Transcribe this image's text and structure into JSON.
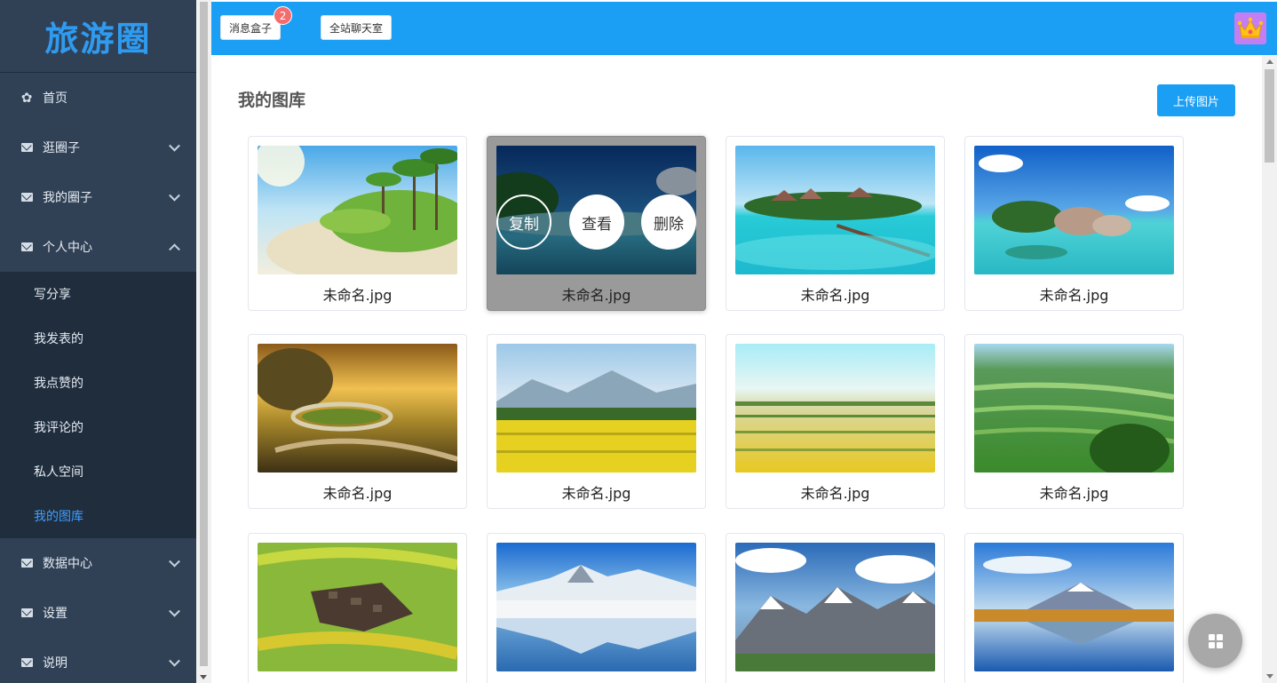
{
  "logo": "旅游圈",
  "sidebar": {
    "items": [
      {
        "label": "首页",
        "icon": "gear-icon"
      },
      {
        "label": "逛圈子",
        "icon": "envelope-icon"
      },
      {
        "label": "我的圈子",
        "icon": "envelope-icon"
      },
      {
        "label": "个人中心",
        "icon": "envelope-icon",
        "expanded": true
      },
      {
        "label": "数据中心",
        "icon": "envelope-icon"
      },
      {
        "label": "设置",
        "icon": "envelope-icon"
      },
      {
        "label": "说明",
        "icon": "envelope-icon"
      }
    ],
    "submenu": [
      {
        "label": "写分享"
      },
      {
        "label": "我发表的"
      },
      {
        "label": "我点赞的"
      },
      {
        "label": "我评论的"
      },
      {
        "label": "私人空间"
      },
      {
        "label": "我的图库",
        "active": true
      }
    ]
  },
  "header": {
    "message_box": "消息盒子",
    "message_badge": "2",
    "chatroom": "全站聊天室",
    "avatar_icon": "crown-icon",
    "bg_color": "#1a9ff5"
  },
  "main": {
    "title": "我的图库",
    "upload_button": "上传图片",
    "hover_actions": {
      "copy": "复制",
      "view": "查看",
      "delete": "删除"
    },
    "images": [
      {
        "name": "未命名.jpg",
        "scene": "beach-palms"
      },
      {
        "name": "未命名.jpg",
        "scene": "sea-island-hover"
      },
      {
        "name": "未命名.jpg",
        "scene": "lagoon-huts"
      },
      {
        "name": "未命名.jpg",
        "scene": "rocky-beach"
      },
      {
        "name": "未命名.jpg",
        "scene": "racetrack-sunset"
      },
      {
        "name": "未命名.jpg",
        "scene": "mountain-fields"
      },
      {
        "name": "未命名.jpg",
        "scene": "yellow-fields"
      },
      {
        "name": "未命名.jpg",
        "scene": "terraces"
      },
      {
        "name": "",
        "scene": "village-terraces"
      },
      {
        "name": "",
        "scene": "snow-lake"
      },
      {
        "name": "",
        "scene": "alps"
      },
      {
        "name": "",
        "scene": "fuji-lake"
      }
    ]
  },
  "fab_icon": "grid-icon"
}
